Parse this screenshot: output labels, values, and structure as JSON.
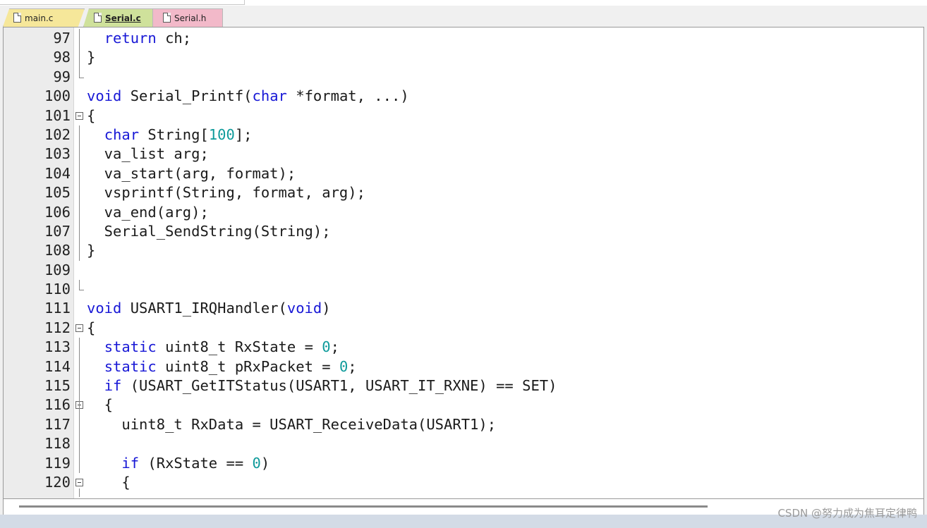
{
  "tabs": [
    {
      "label": "main.c",
      "active": false,
      "color": "#f6e79a"
    },
    {
      "label": "Serial.c",
      "active": true,
      "color": "#cfe19b"
    },
    {
      "label": "Serial.h",
      "active": false,
      "color": "#f2b9c9"
    }
  ],
  "colors": {
    "keyword": "#1818d6",
    "number": "#0f9b9b",
    "comment": "#1a9a1a",
    "gutter": "#ececec"
  },
  "editor": {
    "lines": [
      {
        "n": "97",
        "code": [
          {
            "t": "  "
          },
          {
            "t": "return",
            "c": "kw"
          },
          {
            "t": " ch;"
          }
        ]
      },
      {
        "n": "98",
        "code": [
          {
            "t": "}"
          }
        ]
      },
      {
        "n": "99",
        "code": []
      },
      {
        "n": "100",
        "code": [
          {
            "t": "void",
            "c": "kw"
          },
          {
            "t": " Serial_Printf("
          },
          {
            "t": "char",
            "c": "kw"
          },
          {
            "t": " *format, ...)"
          }
        ]
      },
      {
        "n": "101",
        "code": [
          {
            "t": "{"
          }
        ]
      },
      {
        "n": "102",
        "code": [
          {
            "t": "  "
          },
          {
            "t": "char",
            "c": "kw"
          },
          {
            "t": " String["
          },
          {
            "t": "100",
            "c": "num"
          },
          {
            "t": "];"
          }
        ]
      },
      {
        "n": "103",
        "code": [
          {
            "t": "  va_list arg;"
          }
        ]
      },
      {
        "n": "104",
        "code": [
          {
            "t": "  va_start(arg, format);"
          }
        ]
      },
      {
        "n": "105",
        "code": [
          {
            "t": "  vsprintf(String, format, arg);"
          }
        ]
      },
      {
        "n": "106",
        "code": [
          {
            "t": "  va_end(arg);"
          }
        ]
      },
      {
        "n": "107",
        "code": [
          {
            "t": "  Serial_SendString(String);"
          }
        ]
      },
      {
        "n": "108",
        "code": [
          {
            "t": "}"
          }
        ]
      },
      {
        "n": "109",
        "code": []
      },
      {
        "n": "110",
        "code": []
      },
      {
        "n": "111",
        "code": [
          {
            "t": "void",
            "c": "kw"
          },
          {
            "t": " USART1_IRQHandler("
          },
          {
            "t": "void",
            "c": "kw"
          },
          {
            "t": ")"
          }
        ]
      },
      {
        "n": "112",
        "code": [
          {
            "t": "{"
          }
        ]
      },
      {
        "n": "113",
        "code": [
          {
            "t": "  "
          },
          {
            "t": "static",
            "c": "kw"
          },
          {
            "t": " uint8_t RxState = "
          },
          {
            "t": "0",
            "c": "num"
          },
          {
            "t": ";"
          }
        ]
      },
      {
        "n": "114",
        "code": [
          {
            "t": "  "
          },
          {
            "t": "static",
            "c": "kw"
          },
          {
            "t": " uint8_t pRxPacket = "
          },
          {
            "t": "0",
            "c": "num"
          },
          {
            "t": ";"
          }
        ]
      },
      {
        "n": "115",
        "code": [
          {
            "t": "  "
          },
          {
            "t": "if",
            "c": "kw"
          },
          {
            "t": " (USART_GetITStatus(USART1, USART_IT_RXNE) == SET)"
          }
        ]
      },
      {
        "n": "116",
        "code": [
          {
            "t": "  {"
          }
        ]
      },
      {
        "n": "117",
        "code": [
          {
            "t": "    uint8_t RxData = USART_ReceiveData(USART1);"
          }
        ]
      },
      {
        "n": "118",
        "code": []
      },
      {
        "n": "119",
        "code": [
          {
            "t": "    "
          },
          {
            "t": "if",
            "c": "kw"
          },
          {
            "t": " (RxState == "
          },
          {
            "t": "0",
            "c": "num"
          },
          {
            "t": ")"
          }
        ]
      },
      {
        "n": "120",
        "code": [
          {
            "t": "    {"
          }
        ]
      }
    ]
  },
  "watermark": "CSDN @努力成为焦耳定律鸭"
}
